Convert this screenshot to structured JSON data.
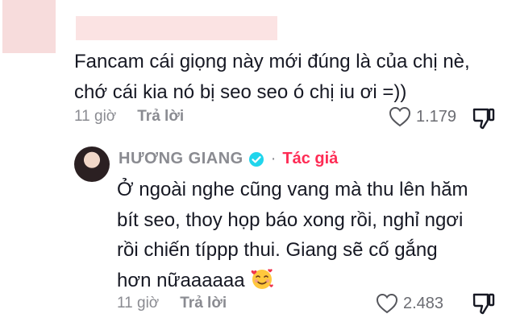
{
  "comments": [
    {
      "text_lines": [
        "Fancam cái giọng này mới đúng là của chị nè,",
        "chớ cái kia nó bị seo seo ó chị iu ơi =))"
      ],
      "time": "11 giờ",
      "reply_label": "Trả lời",
      "likes": "1.179"
    },
    {
      "author": "HƯƠNG GIANG",
      "author_tag": "Tác giả",
      "separator": "·",
      "text_lines": [
        "Ở ngoài nghe cũng vang mà thu lên hăm",
        "bít seo, thoy họp báo xong rồi, nghỉ ngơi",
        "rồi chiến típpp thui. Giang sẽ cố gắng",
        "hơn nữaaaaaa"
      ],
      "emoji": "smiling-face-with-hearts",
      "time": "11 giờ",
      "reply_label": "Trả lời",
      "likes": "2.483"
    }
  ],
  "colors": {
    "accent": "#fe2c55",
    "verified": "#20d5ec",
    "muted": "#8a8b91",
    "text": "#161823"
  }
}
